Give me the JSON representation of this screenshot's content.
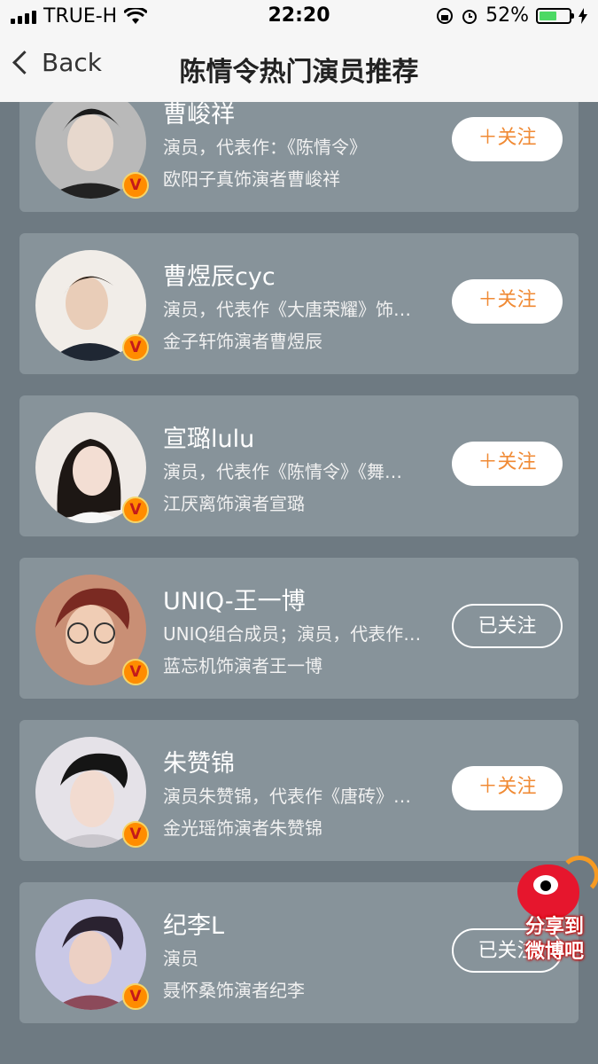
{
  "status": {
    "carrier": "TRUE-H",
    "time": "22:20",
    "battery": "52%"
  },
  "nav": {
    "back_label": "Back",
    "title": "陈情令热门演员推荐"
  },
  "actors": [
    {
      "name": "曹峻祥",
      "desc": "演员，代表作：《陈情令》",
      "role": "欧阳子真饰演者曹峻祥",
      "button": "＋关注",
      "followed": false
    },
    {
      "name": "曹煜辰cyc",
      "desc": "演员，代表作《大唐荣耀》饰…",
      "role": "金子轩饰演者曹煜辰",
      "button": "＋关注",
      "followed": false
    },
    {
      "name": "宣璐lulu",
      "desc": "演员，代表作《陈情令》《舞…",
      "role": "江厌离饰演者宣璐",
      "button": "＋关注",
      "followed": false
    },
    {
      "name": "UNIQ-王一博",
      "desc": "UNIQ组合成员；演员，代表作…",
      "role": "蓝忘机饰演者王一博",
      "button": "已关注",
      "followed": true
    },
    {
      "name": "朱赞锦",
      "desc": "演员朱赞锦，代表作《唐砖》…",
      "role": "金光瑶饰演者朱赞锦",
      "button": "＋关注",
      "followed": false
    },
    {
      "name": "纪李L",
      "desc": "演员",
      "role": "聂怀桑饰演者纪李",
      "button": "已关注",
      "followed": true
    }
  ],
  "verified_badge": "V",
  "share": {
    "line1": "分享到",
    "line2": "微博吧"
  },
  "colors": {
    "follow_text": "#f08a34",
    "card_bg": "#87939a",
    "page_bg": "#6e7a82"
  }
}
